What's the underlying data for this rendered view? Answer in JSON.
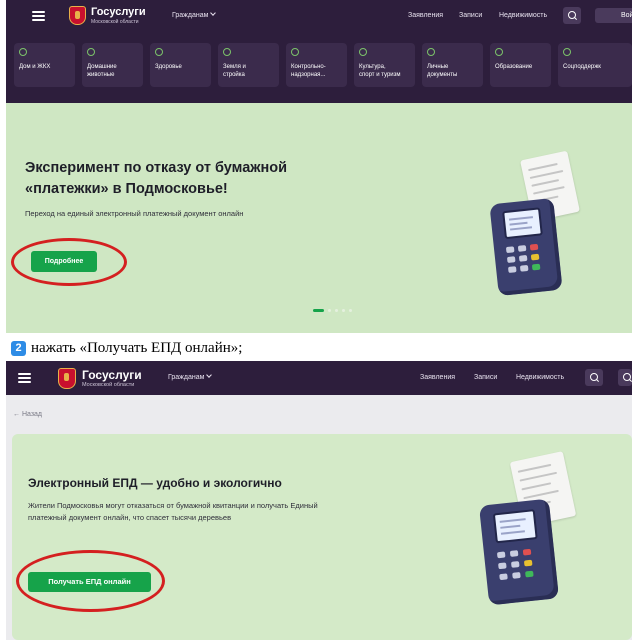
{
  "top": {
    "header": {
      "logo_title": "Госуслуги",
      "logo_subtitle": "Московской области",
      "audience_dropdown": "Гражданам",
      "nav": [
        "Заявления",
        "Записи",
        "Недвижимость"
      ],
      "login_label": "Войти"
    },
    "categories": [
      {
        "label": "Дом и ЖКХ",
        "icon": "sun-icon"
      },
      {
        "label": "Домашние\nживотные",
        "icon": "paw-icon"
      },
      {
        "label": "Здоровье",
        "icon": "heart-icon"
      },
      {
        "label": "Земля и\nстройка",
        "icon": "plant-icon"
      },
      {
        "label": "Контрольно-\nнадзорная...",
        "icon": "shield-icon"
      },
      {
        "label": "Культура,\nспорт и туризм",
        "icon": "globe-icon"
      },
      {
        "label": "Личные\nдокументы",
        "icon": "document-icon"
      },
      {
        "label": "Образование",
        "icon": "graduation-cap-icon"
      },
      {
        "label": "Соцподдержк",
        "icon": "people-icon"
      }
    ],
    "banner": {
      "title": "Эксперимент по отказу от бумажной\n«платежки» в Подмосковье!",
      "subtitle": "Переход на единый электронный платежный документ онлайн",
      "button_label": "Подробнее",
      "carousel_slides": 5,
      "carousel_active": 1
    }
  },
  "caption": {
    "step_number": "2",
    "text": "нажать «Получать ЕПД онлайн»;"
  },
  "bottom": {
    "header": {
      "logo_title": "Госуслуги",
      "logo_subtitle": "Московской области",
      "audience_dropdown": "Гражданам",
      "nav": [
        "Заявления",
        "Записи",
        "Недвижимость"
      ]
    },
    "back_label": "← Назад",
    "banner": {
      "title": "Электронный ЕПД — удобно и экологично",
      "description": "Жители Подмосковья могут отказаться от бумажной квитанции и получать Единый платежный документ онлайн, что спасет тысячи деревьев",
      "button_label": "Получать ЕПД онлайн"
    }
  },
  "colors": {
    "header_bg": "#2d1e3c",
    "banner_bg": "#cfe7c3",
    "accent_green": "#16a34a",
    "highlight_red": "#d42020",
    "step_badge_blue": "#2e8ce6"
  }
}
